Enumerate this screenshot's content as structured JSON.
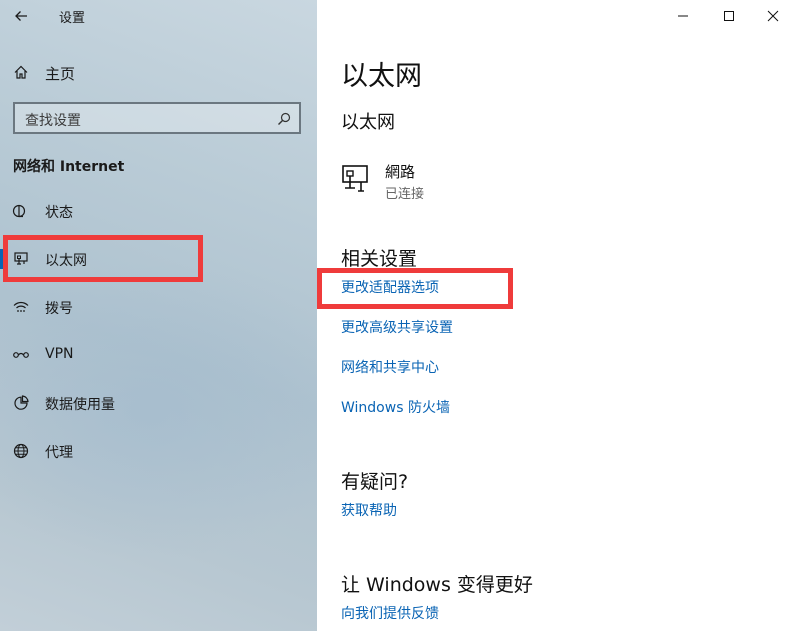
{
  "window": {
    "title": "设置"
  },
  "sidebar": {
    "home_label": "主页",
    "search_placeholder": "查找设置",
    "section_title": "网络和 Internet",
    "items": [
      {
        "label": "状态",
        "icon": "status-icon"
      },
      {
        "label": "以太网",
        "icon": "ethernet-icon",
        "selected": true
      },
      {
        "label": "拨号",
        "icon": "dialup-icon"
      },
      {
        "label": "VPN",
        "icon": "vpn-icon"
      },
      {
        "label": "数据使用量",
        "icon": "data-usage-icon"
      },
      {
        "label": "代理",
        "icon": "globe-icon"
      }
    ]
  },
  "main": {
    "page_title": "以太网",
    "sub_title": "以太网",
    "network": {
      "name": "網路",
      "status": "已连接"
    },
    "related": {
      "heading": "相关设置",
      "links": [
        "更改适配器选项",
        "更改高级共享设置",
        "网络和共享中心",
        "Windows 防火墙"
      ]
    },
    "help": {
      "heading": "有疑问?",
      "link": "获取帮助"
    },
    "feedback": {
      "heading": "让 Windows 变得更好",
      "link": "向我们提供反馈"
    }
  },
  "colors": {
    "accent": "#0a64b4",
    "highlight": "#ef3b3b"
  }
}
